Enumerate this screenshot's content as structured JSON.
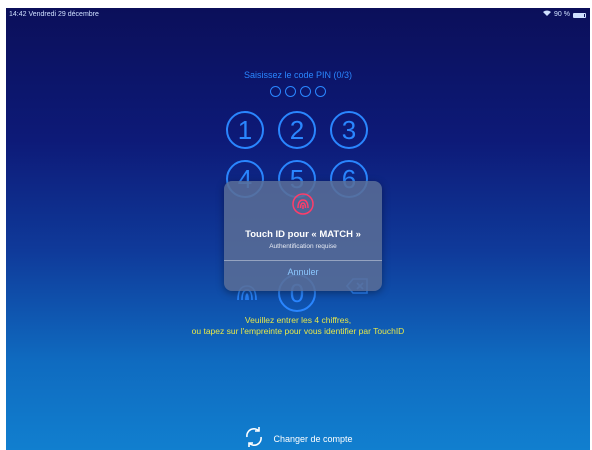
{
  "status_bar": {
    "left_text": "14:42  Vendredi 29 décembre",
    "battery_text": "90 %",
    "battery_level": 0.9,
    "wifi_icon": "wifi-icon"
  },
  "pin_entry": {
    "title": "Saisissez le code PIN (0/3)",
    "digits_entered": 0,
    "digits_total": 4
  },
  "keypad": {
    "keys": [
      "1",
      "2",
      "3",
      "4",
      "5",
      "6",
      "0"
    ],
    "fingerprint_icon": "fingerprint-icon",
    "delete_icon": "delete-icon"
  },
  "instructions": {
    "line1": "Veuillez entrer les 4 chiffres,",
    "line2": "ou tapez sur l'empreinte pour vous identifier par TouchID"
  },
  "switch_account": {
    "label": "Changer de compte",
    "icon": "refresh-icon"
  },
  "touchid_dialog": {
    "title": "Touch ID pour « MATCH »",
    "subtitle": "Authentification requise",
    "cancel_label": "Annuler",
    "icon": "fingerprint-icon"
  },
  "colors": {
    "accent_blue": "#2a86ff",
    "instruction_yellow": "#e6e84a",
    "touchid_red": "#ff3d6a"
  }
}
